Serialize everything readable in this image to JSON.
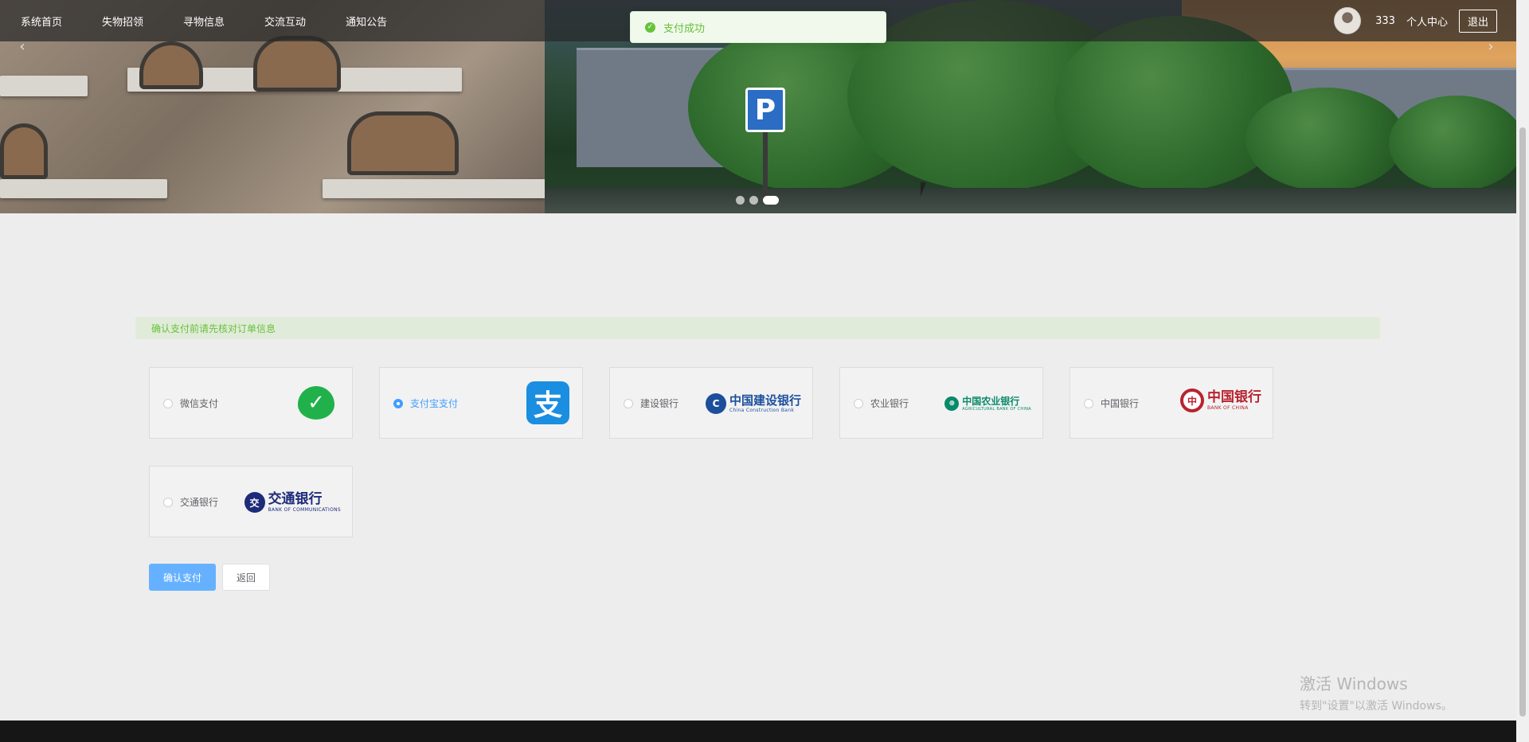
{
  "nav": {
    "links": [
      "系统首页",
      "失物招领",
      "寻物信息",
      "交流互动",
      "通知公告"
    ],
    "username": "333",
    "profile_label": "个人中心",
    "logout_label": "退出"
  },
  "carousel": {
    "prev_glyph": "‹",
    "next_glyph": "›",
    "slide_count": 3,
    "active_index": 2,
    "parking_sign": "P"
  },
  "toast": {
    "message": "支付成功",
    "type": "success",
    "color": "#67c23a"
  },
  "notice": {
    "text": "确认支付前请先核对订单信息"
  },
  "payment": {
    "selected": "alipay",
    "options": [
      {
        "id": "wechat",
        "label": "微信支付",
        "logo_icon": "wechat-icon"
      },
      {
        "id": "alipay",
        "label": "支付宝支付",
        "logo_icon": "alipay-icon",
        "logo_glyph": "支"
      },
      {
        "id": "ccb",
        "label": "建设银行",
        "logo_cn": "中国建设银行",
        "logo_en": "China Construction Bank",
        "brand_color": "#1b4f9c"
      },
      {
        "id": "abc",
        "label": "农业银行",
        "logo_cn": "中国农业银行",
        "logo_en": "AGRICULTURAL BANK OF CHINA",
        "brand_color": "#0a8a6a"
      },
      {
        "id": "boc",
        "label": "中国银行",
        "logo_cn": "中国银行",
        "logo_en": "BANK OF CHINA",
        "brand_color": "#b8232f"
      },
      {
        "id": "bocom",
        "label": "交通银行",
        "logo_cn": "交通银行",
        "logo_en": "BANK OF COMMUNICATIONS",
        "brand_color": "#1d2b7a"
      }
    ],
    "confirm_label": "确认支付",
    "back_label": "返回"
  },
  "watermark": {
    "title": "激活 Windows",
    "subtitle": "转到\"设置\"以激活 Windows。"
  }
}
